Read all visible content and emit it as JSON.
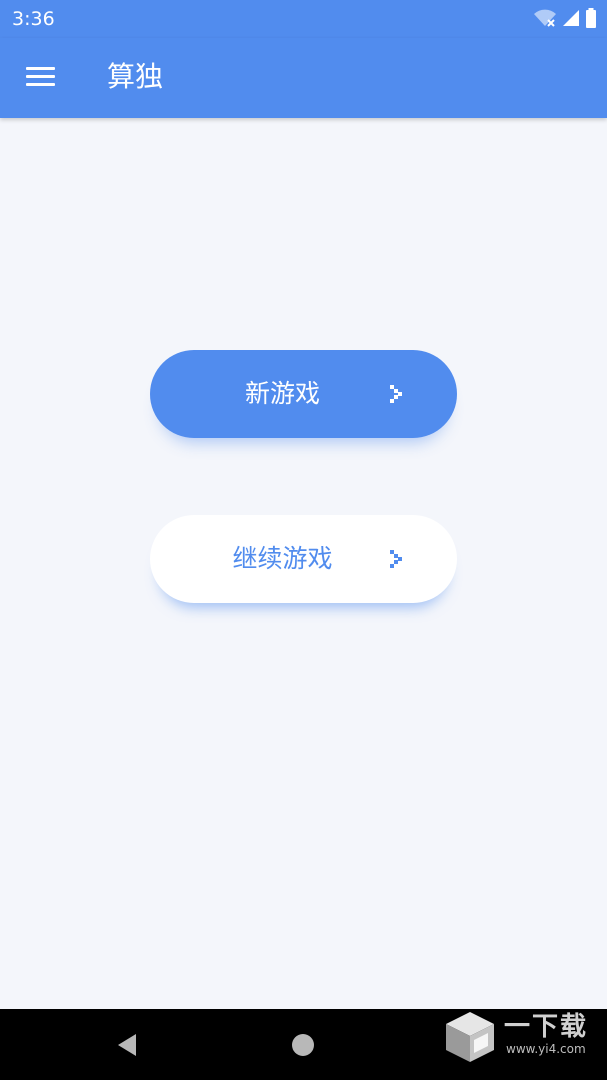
{
  "status_bar": {
    "time": "3:36"
  },
  "app_bar": {
    "title": "算独",
    "menu_icon": "menu-icon"
  },
  "buttons": {
    "new_game": "新游戏",
    "continue_game": "继续游戏",
    "chevron_icon": "chevron-right-icon"
  },
  "colors": {
    "primary": "#518cee",
    "background": "#f4f6fb",
    "button_light": "#ffffff",
    "nav_bar": "#000000"
  },
  "watermark": {
    "brand": "一下载",
    "url": "www.yi4.com"
  }
}
